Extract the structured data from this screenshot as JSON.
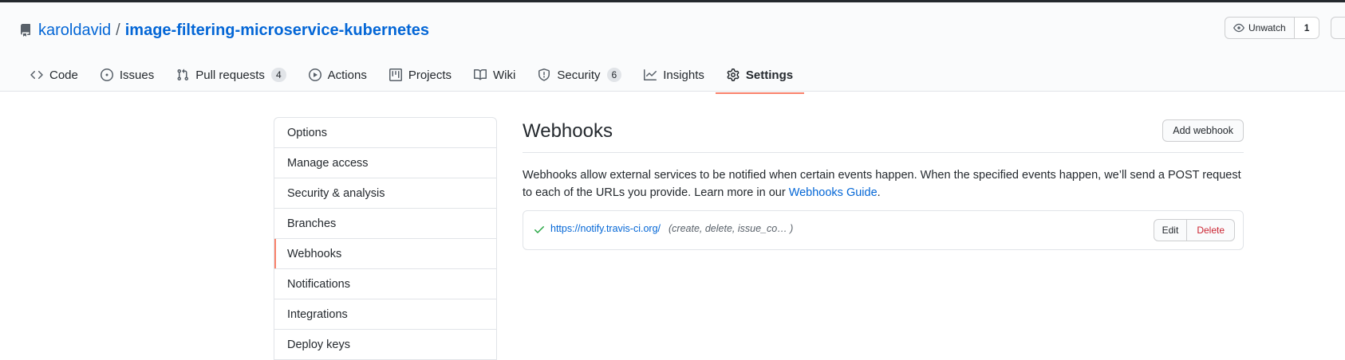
{
  "repo": {
    "owner": "karoldavid",
    "separator": "/",
    "name": "image-filtering-microservice-kubernetes"
  },
  "header_actions": {
    "watch_label": "Unwatch",
    "watch_count": "1"
  },
  "tabs": [
    {
      "label": "Code",
      "icon": "code-icon"
    },
    {
      "label": "Issues",
      "icon": "issue-icon"
    },
    {
      "label": "Pull requests",
      "icon": "pull-request-icon",
      "count": "4"
    },
    {
      "label": "Actions",
      "icon": "play-icon"
    },
    {
      "label": "Projects",
      "icon": "project-icon"
    },
    {
      "label": "Wiki",
      "icon": "book-icon"
    },
    {
      "label": "Security",
      "icon": "shield-icon",
      "count": "6"
    },
    {
      "label": "Insights",
      "icon": "graph-icon"
    },
    {
      "label": "Settings",
      "icon": "gear-icon",
      "selected": true
    }
  ],
  "settings_menu": [
    "Options",
    "Manage access",
    "Security & analysis",
    "Branches",
    "Webhooks",
    "Notifications",
    "Integrations",
    "Deploy keys"
  ],
  "settings_menu_selected": "Webhooks",
  "webhooks": {
    "title": "Webhooks",
    "add_button": "Add webhook",
    "description": "Webhooks allow external services to be notified when certain events happen. When the specified events happen, we’ll send a POST request to each of the URLs you provide. Learn more in our",
    "guide_link": "Webhooks Guide",
    "period": ".",
    "hooks": [
      {
        "url": "https://notify.travis-ci.org/",
        "events": "(create, delete, issue_co…   )",
        "status": "success",
        "edit_label": "Edit",
        "delete_label": "Delete"
      }
    ]
  },
  "colors": {
    "link": "#0366d6",
    "selected_underline": "#f9826c",
    "danger": "#cb2431",
    "success": "#28a745"
  }
}
